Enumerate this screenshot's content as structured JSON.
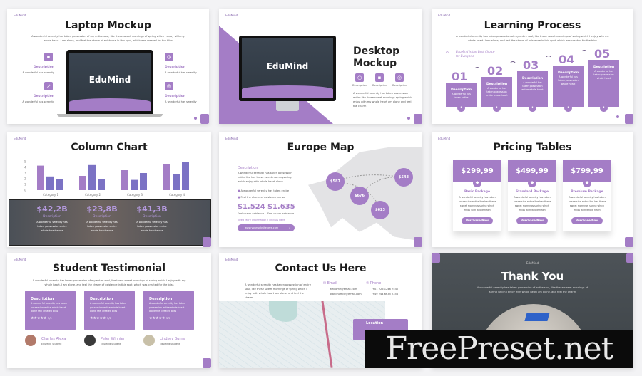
{
  "brand": "EduMind",
  "lorem_long": "A wonderful serenity has taken possession of my entire soul, like these sweet mornings of spring which I enjoy with my whole heart. I am alone, and feel the charm of existence in this spot, which was created for the bliss",
  "lorem_short": "A wonderful has serenity",
  "colors": {
    "accent": "#a47dc6",
    "bar_secondary": "#7b72c4"
  },
  "laptop": {
    "title": "Laptop Mockup",
    "screen_logo": "EduMind",
    "features": [
      {
        "label": "Description",
        "text": "A wonderful has serenity",
        "icon": "briefcase-icon"
      },
      {
        "label": "Description",
        "text": "A wonderful has serenity",
        "icon": "chart-icon"
      },
      {
        "label": "Description",
        "text": "A wonderful has serenity",
        "icon": "clock-icon"
      },
      {
        "label": "Description",
        "text": "A wonderful has serenity",
        "icon": "target-icon"
      }
    ]
  },
  "desktop": {
    "title_line1": "Desktop",
    "title_line2": "Mockup",
    "screen_logo": "EduMind",
    "items": [
      "Description",
      "Description",
      "Description"
    ],
    "text": "A wonderful serenity has taken possession entire like these sweet mornings spring which enjoy with my whole heart am alone and feel the charm"
  },
  "learning": {
    "title": "Learning Process",
    "tagline_line1": "EduMind is the Best Choice",
    "tagline_line2": "for Everyone",
    "steps": [
      {
        "num": "01",
        "label": "Description",
        "text": "A wonderful has taken entire"
      },
      {
        "num": "02",
        "label": "Description",
        "text": "A wonderful has taken possession entire whole heart"
      },
      {
        "num": "03",
        "label": "Description",
        "text": "A wonderful has taken possession entire whole heart"
      },
      {
        "num": "04",
        "label": "Description",
        "text": "A wonderful has taken possession whole heart"
      },
      {
        "num": "05",
        "label": "Description",
        "text": "A wonderful has taken possession whole heart"
      }
    ]
  },
  "column": {
    "title": "Column Chart",
    "stats": [
      {
        "value": "$42,2B",
        "label": "Description",
        "text": "A wonderful serenity has taken possession entire whole heart alone"
      },
      {
        "value": "$23,8B",
        "label": "Description",
        "text": "A wonderful serenity has taken possession entire whole heart alone"
      },
      {
        "value": "$41,3B",
        "label": "Description",
        "text": "A wonderful serenity has taken possession entire whole heart alone"
      }
    ]
  },
  "chart_data": {
    "type": "bar",
    "categories": [
      "Category 1",
      "Category 2",
      "Category 3",
      "Category 4"
    ],
    "series": [
      {
        "values": [
          4.3,
          2.5,
          3.5,
          4.5
        ]
      },
      {
        "values": [
          2.4,
          4.4,
          1.8,
          2.8
        ]
      },
      {
        "values": [
          2.0,
          2.0,
          3.0,
          5.0
        ]
      }
    ],
    "yticks": [
      0,
      1,
      2,
      3,
      4,
      5
    ],
    "ylim": [
      0,
      5
    ],
    "colors": [
      "#a47dc6",
      "#7b72c4",
      "#7b72c4"
    ]
  },
  "europe": {
    "title": "Europe Map",
    "desc_label": "Description",
    "desc_text": "A wonderful serenity has taken possession entire like has these sweet morningspring which enjoy with whole heart alone",
    "bullets": [
      "A wonderful serenity has taken entire",
      "Feel the charm of existence are so"
    ],
    "stats": [
      {
        "value": "$1.524",
        "label": "Feel charm existence"
      },
      {
        "value": "$1.635",
        "label": "Feel charm existence"
      }
    ],
    "link": "Need More Information ? Find Us Here",
    "search_value": "www.yourwebsitehere.com",
    "markers": [
      "$587",
      "$548",
      "$676",
      "$623"
    ]
  },
  "pricing": {
    "title": "Pricing Tables",
    "plans": [
      {
        "price": "$299,99",
        "name": "Basic Package",
        "text": "A wonderful serenity has taken possession entire like has these sweet mornings spring which enjoy with whole heart",
        "button": "Purchase Now"
      },
      {
        "price": "$499,99",
        "name": "Standard Package",
        "text": "A wonderful serenity has taken possession entire like has these sweet mornings spring which enjoy with whole heart",
        "button": "Purchase Now"
      },
      {
        "price": "$799,99",
        "name": "Premium Package",
        "text": "A wonderful serenity has taken possession entire like has these sweet mornings spring which enjoy with whole heart",
        "button": "Purchase Now"
      }
    ]
  },
  "testimonial": {
    "title": "Student Testimonial",
    "cards": [
      {
        "label": "Description",
        "text": "A wonderful serenity has taken possession entire whole heart alone feel created bliss",
        "rating": "5/5",
        "name": "Charles Alexa",
        "role": "EduMind Student"
      },
      {
        "label": "Description",
        "text": "A wonderful serenity has taken possession entire whole heart alone feel created bliss",
        "rating": "5/5",
        "name": "Peter Winnier",
        "role": "EduMind Student"
      },
      {
        "label": "Description",
        "text": "A wonderful serenity has taken possession entire whole heart alone feel created bliss",
        "rating": "5/5",
        "name": "Lindsey Burns",
        "role": "EduMind Student"
      }
    ]
  },
  "contact": {
    "title": "Contact Us Here",
    "text": "A wonderful serenity has taken possession of entire soul, like these sweet mornings of spring which I enjoy with whole heart am alone, and feel the charm",
    "email_label": "Email",
    "emails": [
      "welcome@email.com",
      "branchoffice@email.com"
    ],
    "phone_label": "Phone",
    "phones": [
      "+01 226 1246 7540",
      "+49 244 6635 2356"
    ],
    "location_label": "Location"
  },
  "thanks": {
    "title": "Thank You",
    "text": "A wonderful serenity has taken possession of entire soul, like these sweet mornings of spring which I enjoy with whole heart am alone, and feel the charm"
  },
  "watermark": "FreePreset.net"
}
